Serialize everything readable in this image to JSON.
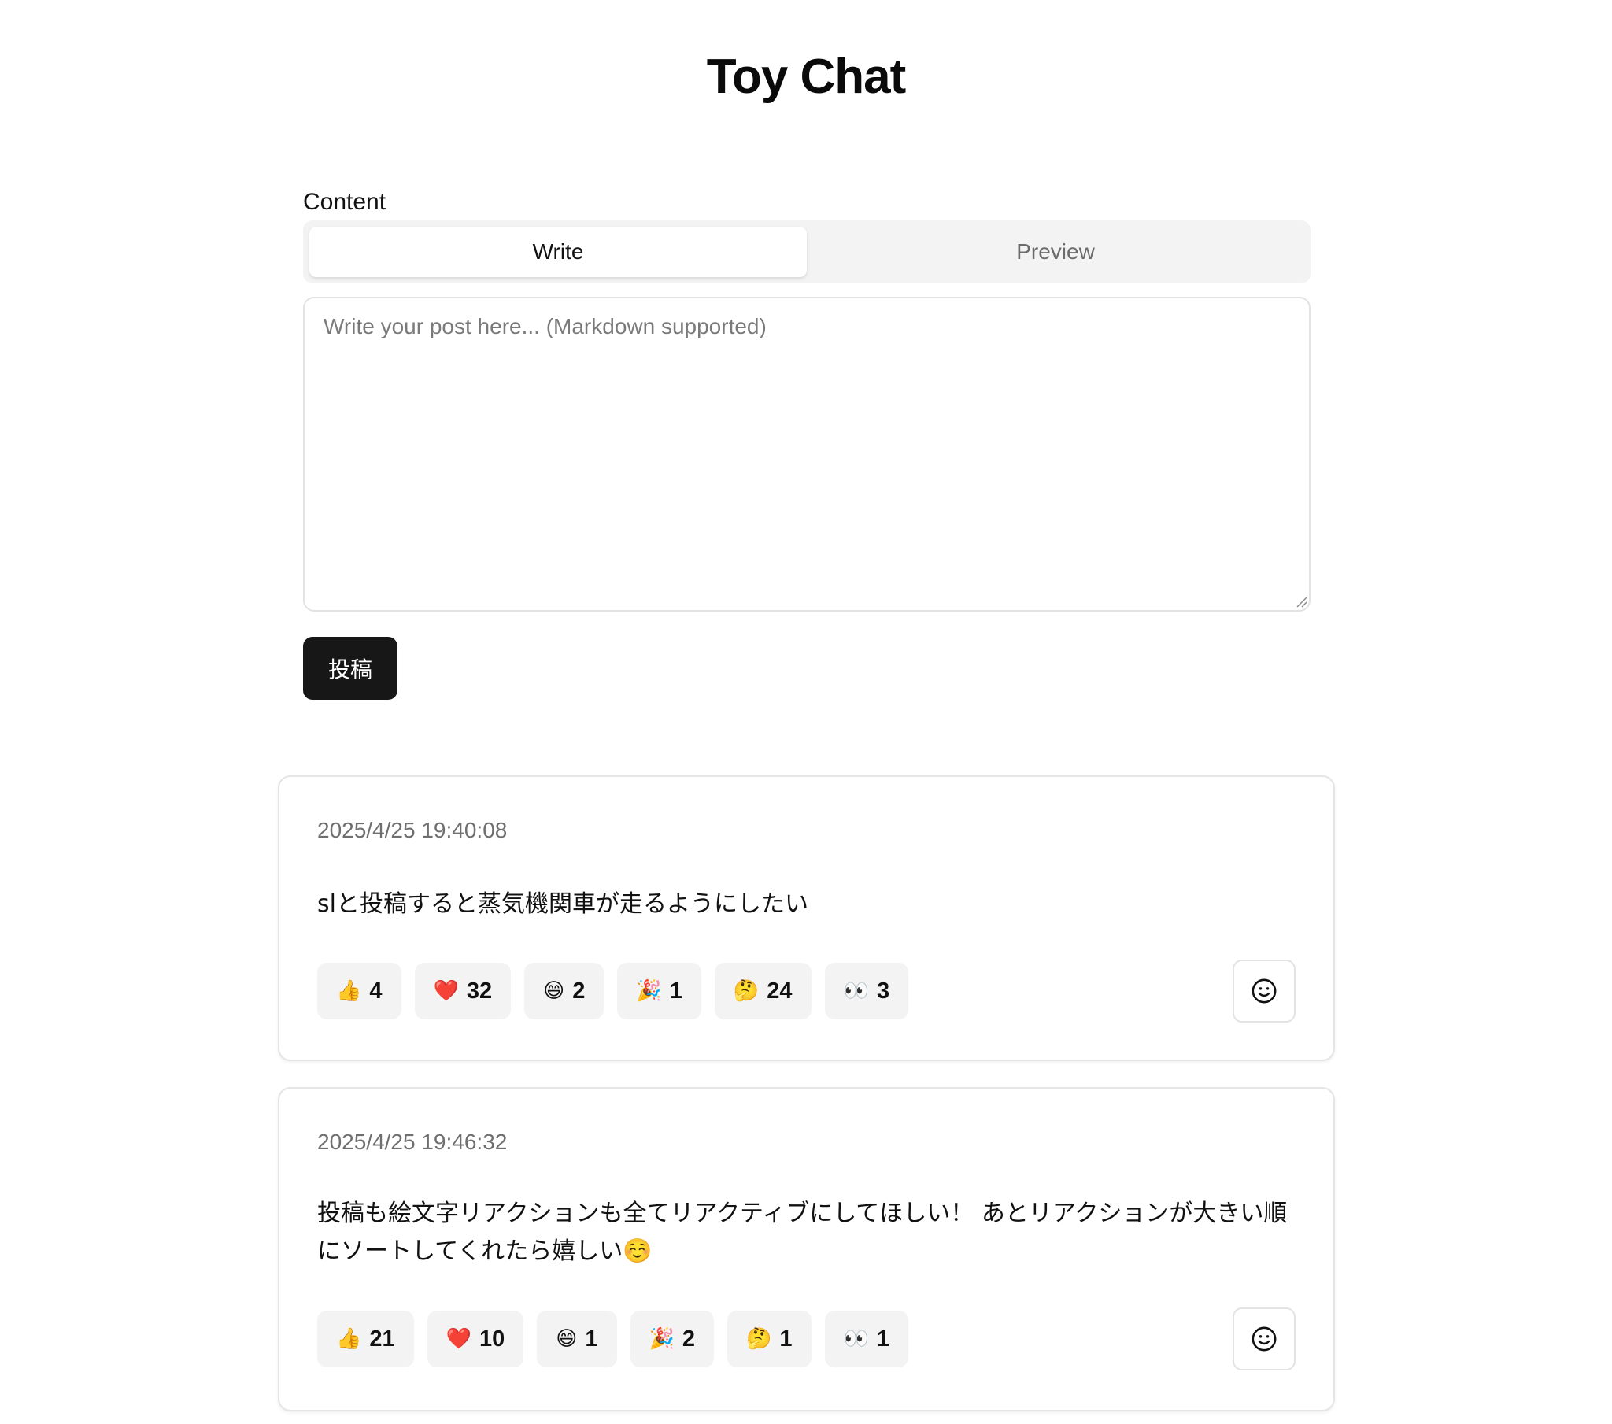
{
  "app": {
    "title": "Toy Chat"
  },
  "composer": {
    "label": "Content",
    "tabs": [
      {
        "label": "Write",
        "active": true
      },
      {
        "label": "Preview",
        "active": false
      }
    ],
    "placeholder": "Write your post here... (Markdown supported)",
    "value": "",
    "submit_label": "投稿"
  },
  "posts": [
    {
      "timestamp": "2025/4/25 19:40:08",
      "body": "slと投稿すると蒸気機関車が走るようにしたい",
      "reactions": [
        {
          "emoji": "👍",
          "icon": "thumbs-up-icon",
          "count": "4"
        },
        {
          "emoji": "❤️",
          "icon": "heart-icon",
          "count": "32"
        },
        {
          "emoji": "😄",
          "icon": "grinning-face-icon",
          "count": "2"
        },
        {
          "emoji": "🎉",
          "icon": "party-popper-icon",
          "count": "1"
        },
        {
          "emoji": "🤔",
          "icon": "thinking-face-icon",
          "count": "24"
        },
        {
          "emoji": "👀",
          "icon": "eyes-icon",
          "count": "3"
        }
      ]
    },
    {
      "timestamp": "2025/4/25 19:46:32",
      "body": "投稿も絵文字リアクションも全てリアクティブにしてほしい！ あとリアクションが大きい順にソートしてくれたら嬉しい☺️",
      "reactions": [
        {
          "emoji": "👍",
          "icon": "thumbs-up-icon",
          "count": "21"
        },
        {
          "emoji": "❤️",
          "icon": "heart-icon",
          "count": "10"
        },
        {
          "emoji": "😄",
          "icon": "grinning-face-icon",
          "count": "1"
        },
        {
          "emoji": "🎉",
          "icon": "party-popper-icon",
          "count": "2"
        },
        {
          "emoji": "🤔",
          "icon": "thinking-face-icon",
          "count": "1"
        },
        {
          "emoji": "👀",
          "icon": "eyes-icon",
          "count": "1"
        }
      ]
    }
  ],
  "colors": {
    "primary_button": "#171717",
    "tab_track": "#f3f3f3",
    "reaction_chip": "#f3f3f3",
    "muted_text": "#6f6f6f",
    "heart": "#e0245e"
  }
}
